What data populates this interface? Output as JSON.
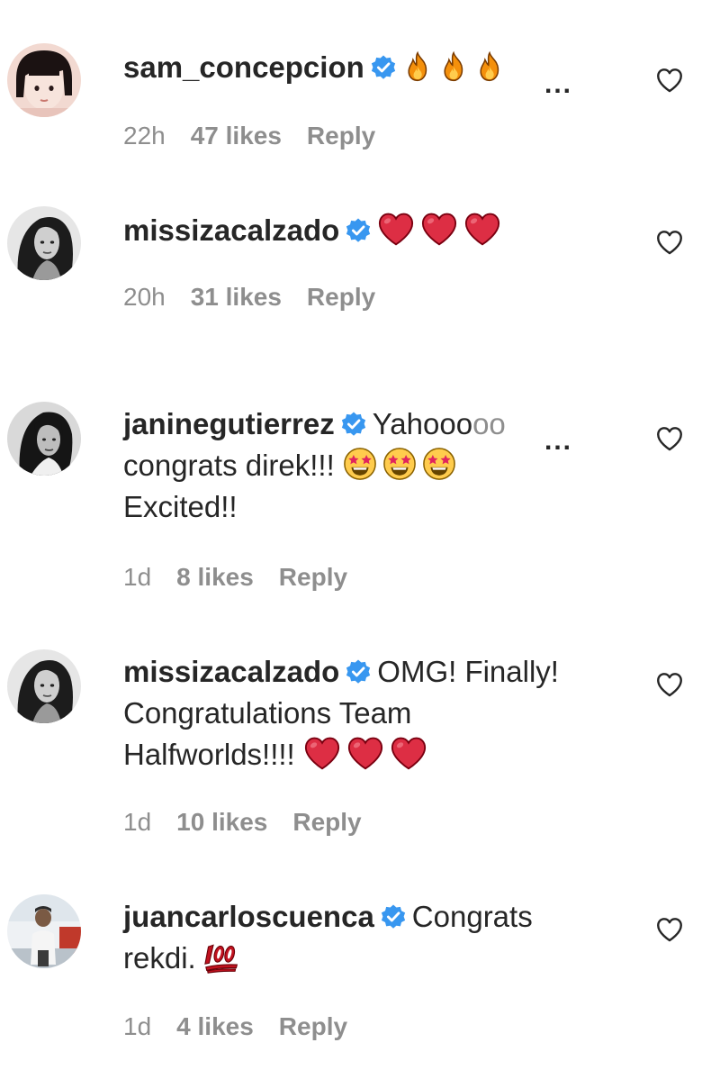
{
  "comments": [
    {
      "username": "sam_concepcion",
      "text": "",
      "emojis": [
        "fire",
        "fire",
        "fire"
      ],
      "truncated": true,
      "time": "22h",
      "likes": "47 likes",
      "reply": "Reply"
    },
    {
      "username": "missizacalzado",
      "text": "",
      "emojis": [
        "red-heart",
        "red-heart",
        "red-heart"
      ],
      "time": "20h",
      "likes": "31 likes",
      "reply": "Reply"
    },
    {
      "username": "janinegutierrez",
      "text_line1": "Yahooo",
      "text_fade": "oo",
      "text_line2": "congrats direk!!!",
      "emojis": [
        "star-struck",
        "star-struck",
        "star-struck"
      ],
      "text_line3": "Excited!!",
      "truncated": true,
      "time": "1d",
      "likes": "8 likes",
      "reply": "Reply"
    },
    {
      "username": "missizacalzado",
      "text_line1": "OMG! Finally!",
      "text_line2": "Congratulations Team",
      "text_line3": "Halfworlds!!!!",
      "emojis": [
        "red-heart",
        "red-heart",
        "red-heart"
      ],
      "time": "1d",
      "likes": "10 likes",
      "reply": "Reply"
    },
    {
      "username": "juancarloscuenca",
      "text_line1": "Congrats",
      "text_line2": "rekdi.",
      "emojis": [
        "hundred-points"
      ],
      "time": "1d",
      "likes": "4 likes",
      "reply": "Reply"
    }
  ],
  "more_label": "...",
  "colors": {
    "verified": "#3897f0",
    "text": "#262626",
    "meta": "#8e8e8e",
    "heart_emoji": "#d8101c"
  }
}
